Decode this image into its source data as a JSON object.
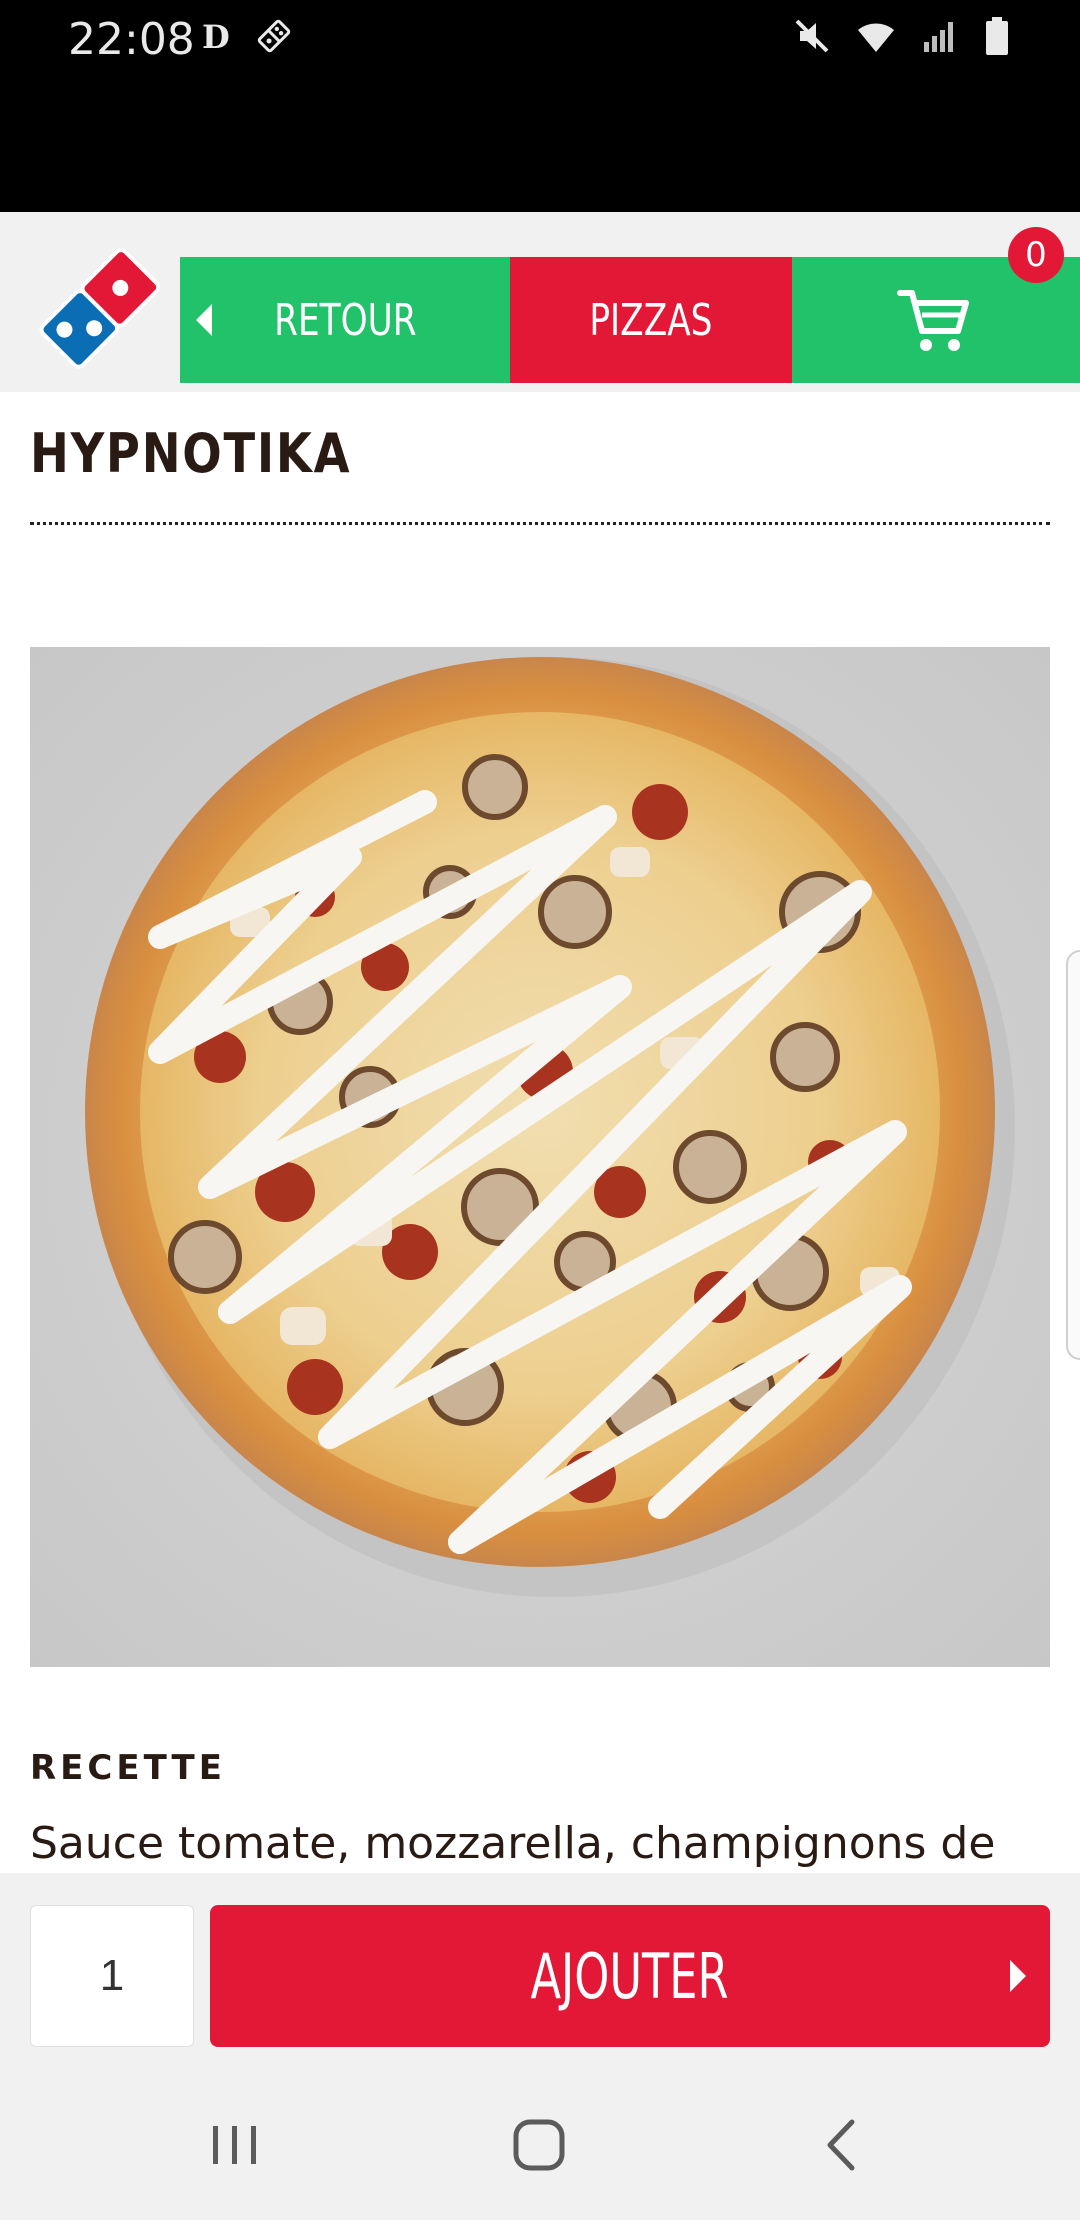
{
  "status_bar": {
    "time": "22:08"
  },
  "header": {
    "back_label": "RETOUR",
    "category_label": "PIZZAS",
    "cart_count": "0"
  },
  "product": {
    "title": "HYPNOTIKA",
    "recipe_heading": "RECETTE",
    "recipe_text": "Sauce tomate, mozzarella, champignons de"
  },
  "add_bar": {
    "quantity": "1",
    "add_label": "AJOUTER"
  },
  "colors": {
    "green": "#22c26b",
    "red": "#e31837",
    "dark_text": "#2a1a14"
  },
  "icons": [
    "logo-icon",
    "back-arrow-icon",
    "cart-icon",
    "mute-icon",
    "wifi-icon",
    "signal-icon",
    "battery-icon",
    "recents-icon",
    "home-icon",
    "back-icon"
  ]
}
